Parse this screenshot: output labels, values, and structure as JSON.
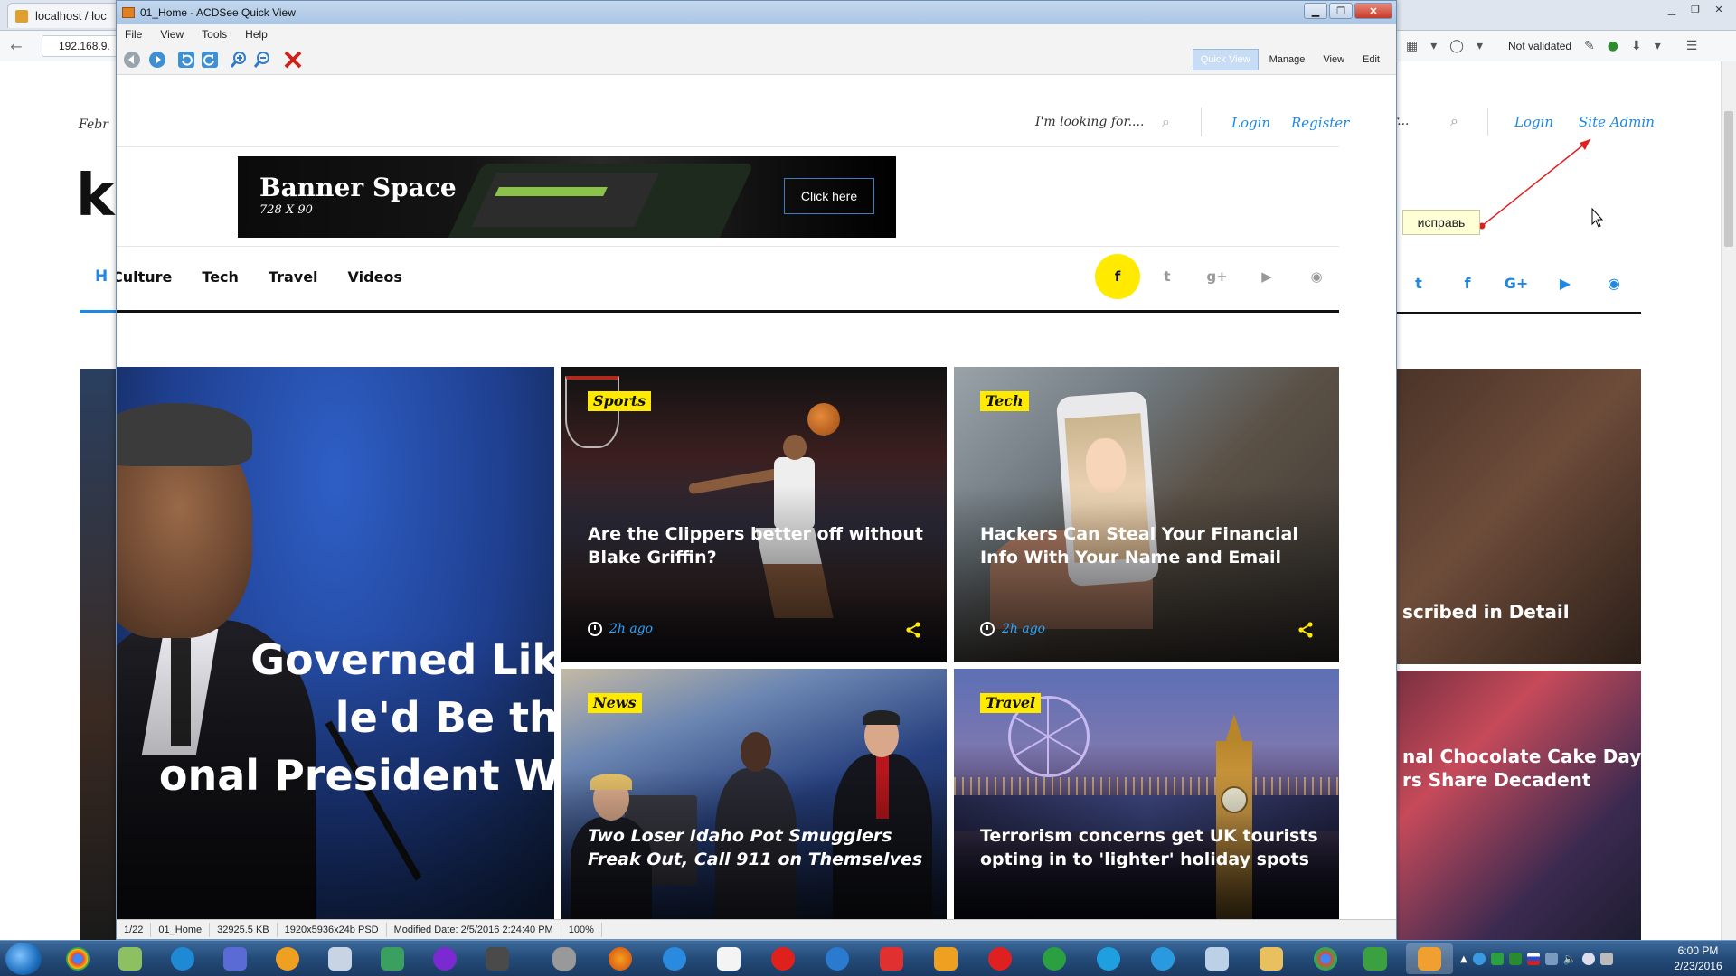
{
  "browser": {
    "tab_title": "localhost / loc",
    "address": "192.168.9.",
    "not_validated": "Not validated",
    "page": {
      "date_partial": "Febr",
      "logo_partial": "ki",
      "search_tail": "r...",
      "login": "Login",
      "site_admin": "Site Admin",
      "note": "исправь",
      "nav_partial": "H",
      "right_card_1_title": "scribed in Detail",
      "right_card_2_title_l1": "nal Chocolate Cake Day!",
      "right_card_2_title_l2": "rs Share Decadent"
    }
  },
  "viewer": {
    "title": "01_Home - ACDSee Quick View",
    "menu": [
      "File",
      "View",
      "Tools",
      "Help"
    ],
    "modes": {
      "quick_view": "Quick View",
      "manage": "Manage",
      "view": "View",
      "edit": "Edit"
    },
    "status": {
      "index": "1/22",
      "name": "01_Home",
      "size": "32925.5 KB",
      "dims": "1920x5936x24b PSD",
      "modified": "Modified Date: 2/5/2016 2:24:40 PM",
      "zoom": "100%"
    }
  },
  "site": {
    "search_placeholder": "I'm looking for....",
    "login": "Login",
    "register": "Register",
    "banner": {
      "title": "Banner Space",
      "size": "728 X 90",
      "button": "Click here"
    },
    "nav": [
      "Culture",
      "Tech",
      "Travel",
      "Videos"
    ],
    "hero_title": [
      "Governed Like",
      "le'd Be the",
      "onal President We"
    ],
    "cards": [
      {
        "category": "Sports",
        "title": "Are the Clippers better off without Blake Griffin?",
        "time": "2h ago"
      },
      {
        "category": "Tech",
        "title": "Hackers Can Steal Your Financial Info With Your Name and Email",
        "time": "2h ago"
      },
      {
        "category": "News",
        "title": "Two Loser Idaho Pot Smugglers Freak Out, Call 911 on Themselves"
      },
      {
        "category": "Travel",
        "title": "Terrorism concerns get UK tourists opting in to 'lighter' holiday spots"
      }
    ]
  },
  "taskbar": {
    "time": "6:00 PM",
    "date": "2/23/2016"
  },
  "colors": {
    "accent_blue": "#1e88e5",
    "category_yellow": "#ffea00",
    "time_blue": "#29a3ff"
  }
}
